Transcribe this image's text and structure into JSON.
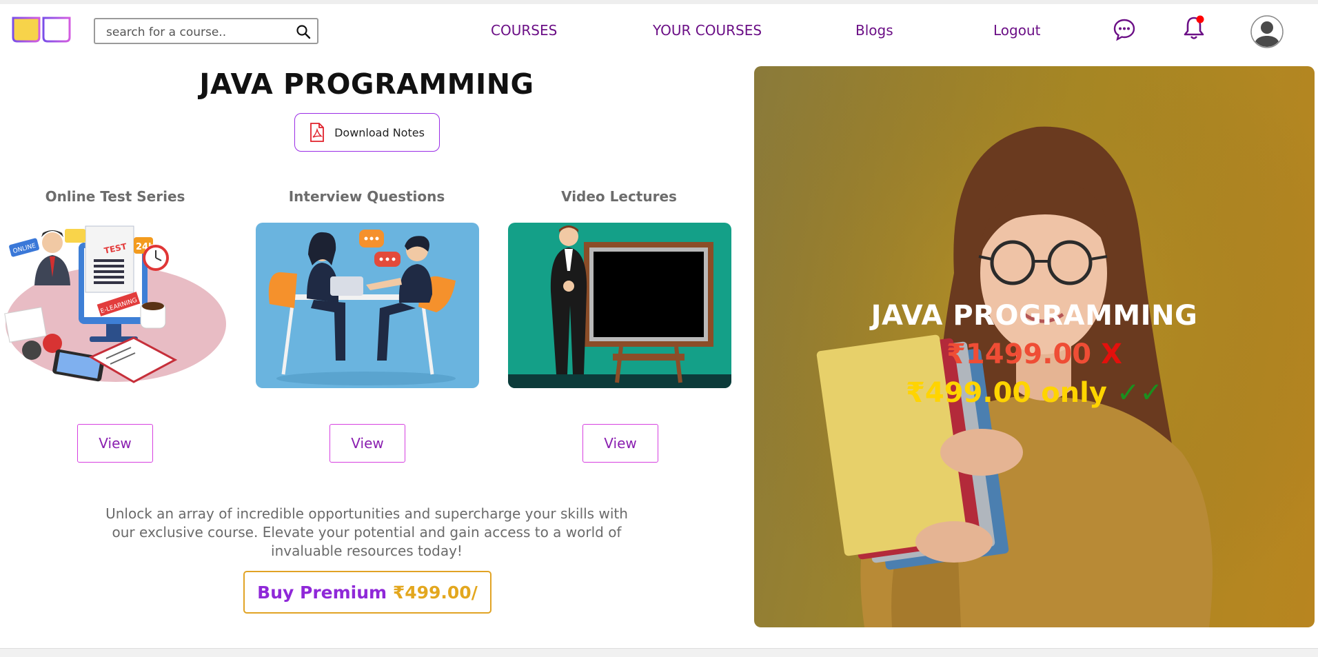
{
  "header": {
    "search": {
      "placeholder": "search for a course.."
    },
    "nav": [
      {
        "label": "COURSES"
      },
      {
        "label": "YOUR COURSES"
      },
      {
        "label": "Blogs"
      },
      {
        "label": "Logout"
      }
    ],
    "icons": [
      "logo-icon",
      "search-icon",
      "chat-icon",
      "bell-icon",
      "avatar-icon"
    ],
    "colors": {
      "nav": "#6b0f86",
      "notification_dot": "#ff0000"
    }
  },
  "course": {
    "title": "JAVA PROGRAMMING",
    "download_label": "Download Notes"
  },
  "cards": [
    {
      "label": "Online Test Series",
      "button": "View"
    },
    {
      "label": "Interview Questions",
      "button": "View"
    },
    {
      "label": "Video Lectures",
      "button": "View"
    }
  ],
  "promo": {
    "text": "Unlock an array of incredible opportunities and supercharge your skills with our exclusive course. Elevate your potential and gain access to a world of invaluable resources today!",
    "buy_label": "Buy Premium",
    "buy_price": "₹499.00/"
  },
  "hero": {
    "title": "JAVA PROGRAMMING",
    "old_price": "₹1499.00",
    "old_mark": "X",
    "new_price": "₹499.00 only",
    "new_mark": "✓✓",
    "colors": {
      "old_price": "#ef4d35",
      "new_price": "#ffd400",
      "ticks": "#1b8f1e"
    }
  }
}
